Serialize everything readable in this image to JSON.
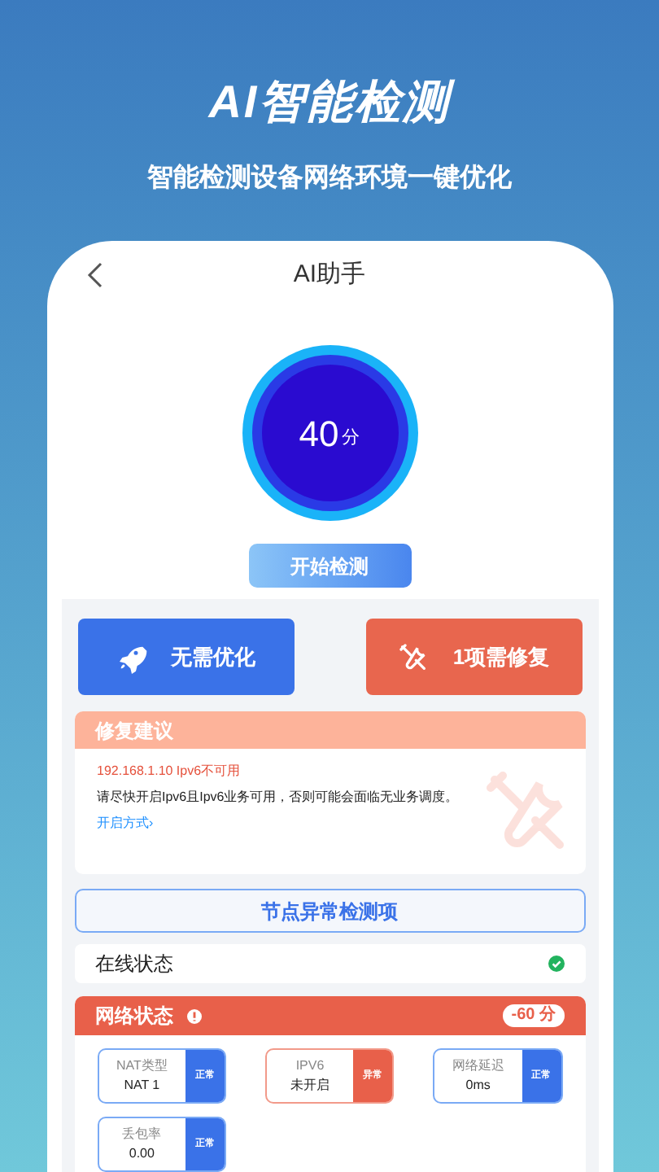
{
  "hero": {
    "title": "AI智能检测",
    "subtitle": "智能检测设备网络环境一键优化"
  },
  "header": {
    "title": "AI助手"
  },
  "score": {
    "value": "40",
    "unit": "分"
  },
  "start_button": "开始检测",
  "actions": [
    {
      "kind": "optimize",
      "label": "无需优化"
    },
    {
      "kind": "repair",
      "label": "1项需修复"
    }
  ],
  "repair_card": {
    "title": "修复建议",
    "issue": "192.168.1.10 Ipv6不可用",
    "advice": "请尽快开启Ipv6且Ipv6业务可用，否则可能会面临无业务调度。",
    "link": "开启方式›"
  },
  "node_button": "节点异常检测项",
  "online_status": {
    "label": "在线状态",
    "ok": true
  },
  "network_status": {
    "title": "网络状态",
    "penalty": "-60 分",
    "metrics": [
      {
        "label": "NAT类型",
        "value": "NAT 1",
        "status": "正常",
        "kind": "normal"
      },
      {
        "label": "IPV6",
        "value": "未开启",
        "status": "异常",
        "kind": "abnormal"
      },
      {
        "label": "网络延迟",
        "value": "0ms",
        "status": "正常",
        "kind": "normal"
      },
      {
        "label": "丢包率",
        "value": "0.00",
        "status": "正常",
        "kind": "normal"
      }
    ]
  }
}
